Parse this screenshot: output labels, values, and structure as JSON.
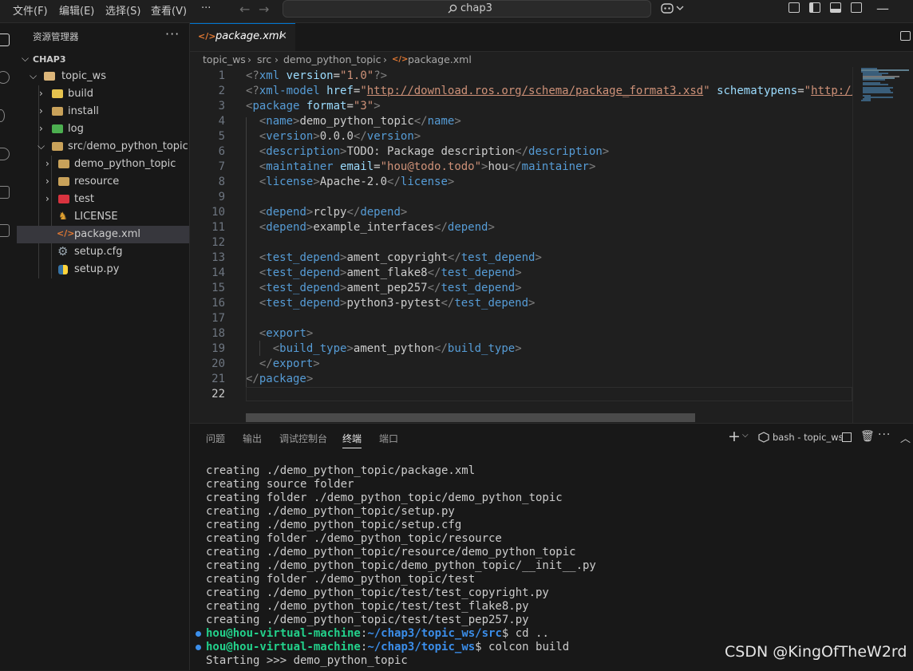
{
  "menu": [
    "文件(F)",
    "编辑(E)",
    "选择(S)",
    "查看(V)",
    "···"
  ],
  "command_center": {
    "text": "chap3",
    "icon": "search-icon"
  },
  "explorer": {
    "title": "资源管理器",
    "more": "···",
    "root": "CHAP3",
    "items": [
      {
        "label": "topic_ws",
        "icon": "folder-open-icon"
      },
      {
        "label": "build",
        "icon": "folder-icon"
      },
      {
        "label": "install",
        "icon": "folder-icon"
      },
      {
        "label": "log",
        "icon": "folder-icon"
      },
      {
        "label": "src",
        "sep": "/",
        "label2": "demo_python_topic",
        "icon": "folder-open-icon"
      },
      {
        "label": "demo_python_topic",
        "icon": "folder-icon"
      },
      {
        "label": "resource",
        "icon": "folder-icon"
      },
      {
        "label": "test",
        "icon": "folder-icon"
      },
      {
        "label": "LICENSE",
        "icon": "license-icon"
      },
      {
        "label": "package.xml",
        "icon": "xml-file-icon",
        "selected": true
      },
      {
        "label": "setup.cfg",
        "icon": "gear-file-icon"
      },
      {
        "label": "setup.py",
        "icon": "python-file-icon"
      }
    ]
  },
  "editor": {
    "tab": {
      "label": "package.xml",
      "icon": "xml-file-icon",
      "close": "✕"
    },
    "breadcrumb": [
      "topic_ws",
      "src",
      "demo_python_topic",
      "package.xml"
    ],
    "line_numbers": [
      "1",
      "2",
      "3",
      "4",
      "5",
      "6",
      "7",
      "8",
      "9",
      "10",
      "11",
      "12",
      "13",
      "14",
      "15",
      "16",
      "17",
      "18",
      "19",
      "20",
      "21",
      "22"
    ],
    "lines": [
      [
        {
          "c": "br",
          "t": "<?"
        },
        {
          "c": "tag",
          "t": "xml "
        },
        {
          "c": "attr",
          "t": "version"
        },
        {
          "c": "txt",
          "t": "="
        },
        {
          "c": "str",
          "t": "\"1.0\""
        },
        {
          "c": "br",
          "t": "?>"
        }
      ],
      [
        {
          "c": "br",
          "t": "<?"
        },
        {
          "c": "tag",
          "t": "xml-model "
        },
        {
          "c": "attr",
          "t": "href"
        },
        {
          "c": "txt",
          "t": "="
        },
        {
          "c": "str",
          "t": "\""
        },
        {
          "c": "link",
          "t": "http://download.ros.org/schema/package_format3.xsd"
        },
        {
          "c": "str",
          "t": "\""
        },
        {
          "c": "txt",
          "t": " "
        },
        {
          "c": "attr",
          "t": "schematypens"
        },
        {
          "c": "txt",
          "t": "="
        },
        {
          "c": "str",
          "t": "\""
        },
        {
          "c": "link",
          "t": "http://"
        }
      ],
      [
        {
          "c": "br",
          "t": "<"
        },
        {
          "c": "tag",
          "t": "package "
        },
        {
          "c": "attr",
          "t": "format"
        },
        {
          "c": "txt",
          "t": "="
        },
        {
          "c": "str",
          "t": "\"3\""
        },
        {
          "c": "br",
          "t": ">"
        }
      ],
      [
        {
          "c": "txt",
          "t": "  "
        },
        {
          "c": "br",
          "t": "<"
        },
        {
          "c": "tag",
          "t": "name"
        },
        {
          "c": "br",
          "t": ">"
        },
        {
          "c": "txt",
          "t": "demo_python_topic"
        },
        {
          "c": "br",
          "t": "</"
        },
        {
          "c": "tag",
          "t": "name"
        },
        {
          "c": "br",
          "t": ">"
        }
      ],
      [
        {
          "c": "txt",
          "t": "  "
        },
        {
          "c": "br",
          "t": "<"
        },
        {
          "c": "tag",
          "t": "version"
        },
        {
          "c": "br",
          "t": ">"
        },
        {
          "c": "txt",
          "t": "0.0.0"
        },
        {
          "c": "br",
          "t": "</"
        },
        {
          "c": "tag",
          "t": "version"
        },
        {
          "c": "br",
          "t": ">"
        }
      ],
      [
        {
          "c": "txt",
          "t": "  "
        },
        {
          "c": "br",
          "t": "<"
        },
        {
          "c": "tag",
          "t": "description"
        },
        {
          "c": "br",
          "t": ">"
        },
        {
          "c": "txt",
          "t": "TODO: Package description"
        },
        {
          "c": "br",
          "t": "</"
        },
        {
          "c": "tag",
          "t": "description"
        },
        {
          "c": "br",
          "t": ">"
        }
      ],
      [
        {
          "c": "txt",
          "t": "  "
        },
        {
          "c": "br",
          "t": "<"
        },
        {
          "c": "tag",
          "t": "maintainer "
        },
        {
          "c": "attr",
          "t": "email"
        },
        {
          "c": "txt",
          "t": "="
        },
        {
          "c": "str",
          "t": "\"hou@todo.todo\""
        },
        {
          "c": "br",
          "t": ">"
        },
        {
          "c": "txt",
          "t": "hou"
        },
        {
          "c": "br",
          "t": "</"
        },
        {
          "c": "tag",
          "t": "maintainer"
        },
        {
          "c": "br",
          "t": ">"
        }
      ],
      [
        {
          "c": "txt",
          "t": "  "
        },
        {
          "c": "br",
          "t": "<"
        },
        {
          "c": "tag",
          "t": "license"
        },
        {
          "c": "br",
          "t": ">"
        },
        {
          "c": "txt",
          "t": "Apache-2.0"
        },
        {
          "c": "br",
          "t": "</"
        },
        {
          "c": "tag",
          "t": "license"
        },
        {
          "c": "br",
          "t": ">"
        }
      ],
      [],
      [
        {
          "c": "txt",
          "t": "  "
        },
        {
          "c": "br",
          "t": "<"
        },
        {
          "c": "tag",
          "t": "depend"
        },
        {
          "c": "br",
          "t": ">"
        },
        {
          "c": "txt",
          "t": "rclpy"
        },
        {
          "c": "br",
          "t": "</"
        },
        {
          "c": "tag",
          "t": "depend"
        },
        {
          "c": "br",
          "t": ">"
        }
      ],
      [
        {
          "c": "txt",
          "t": "  "
        },
        {
          "c": "br",
          "t": "<"
        },
        {
          "c": "tag",
          "t": "depend"
        },
        {
          "c": "br",
          "t": ">"
        },
        {
          "c": "txt",
          "t": "example_interfaces"
        },
        {
          "c": "br",
          "t": "</"
        },
        {
          "c": "tag",
          "t": "depend"
        },
        {
          "c": "br",
          "t": ">"
        }
      ],
      [],
      [
        {
          "c": "txt",
          "t": "  "
        },
        {
          "c": "br",
          "t": "<"
        },
        {
          "c": "tag",
          "t": "test_depend"
        },
        {
          "c": "br",
          "t": ">"
        },
        {
          "c": "txt",
          "t": "ament_copyright"
        },
        {
          "c": "br",
          "t": "</"
        },
        {
          "c": "tag",
          "t": "test_depend"
        },
        {
          "c": "br",
          "t": ">"
        }
      ],
      [
        {
          "c": "txt",
          "t": "  "
        },
        {
          "c": "br",
          "t": "<"
        },
        {
          "c": "tag",
          "t": "test_depend"
        },
        {
          "c": "br",
          "t": ">"
        },
        {
          "c": "txt",
          "t": "ament_flake8"
        },
        {
          "c": "br",
          "t": "</"
        },
        {
          "c": "tag",
          "t": "test_depend"
        },
        {
          "c": "br",
          "t": ">"
        }
      ],
      [
        {
          "c": "txt",
          "t": "  "
        },
        {
          "c": "br",
          "t": "<"
        },
        {
          "c": "tag",
          "t": "test_depend"
        },
        {
          "c": "br",
          "t": ">"
        },
        {
          "c": "txt",
          "t": "ament_pep257"
        },
        {
          "c": "br",
          "t": "</"
        },
        {
          "c": "tag",
          "t": "test_depend"
        },
        {
          "c": "br",
          "t": ">"
        }
      ],
      [
        {
          "c": "txt",
          "t": "  "
        },
        {
          "c": "br",
          "t": "<"
        },
        {
          "c": "tag",
          "t": "test_depend"
        },
        {
          "c": "br",
          "t": ">"
        },
        {
          "c": "txt",
          "t": "python3-pytest"
        },
        {
          "c": "br",
          "t": "</"
        },
        {
          "c": "tag",
          "t": "test_depend"
        },
        {
          "c": "br",
          "t": ">"
        }
      ],
      [],
      [
        {
          "c": "txt",
          "t": "  "
        },
        {
          "c": "br",
          "t": "<"
        },
        {
          "c": "tag",
          "t": "export"
        },
        {
          "c": "br",
          "t": ">"
        }
      ],
      [
        {
          "c": "txt",
          "t": "    "
        },
        {
          "c": "br",
          "t": "<"
        },
        {
          "c": "tag",
          "t": "build_type"
        },
        {
          "c": "br",
          "t": ">"
        },
        {
          "c": "txt",
          "t": "ament_python"
        },
        {
          "c": "br",
          "t": "</"
        },
        {
          "c": "tag",
          "t": "build_type"
        },
        {
          "c": "br",
          "t": ">"
        }
      ],
      [
        {
          "c": "txt",
          "t": "  "
        },
        {
          "c": "br",
          "t": "</"
        },
        {
          "c": "tag",
          "t": "export"
        },
        {
          "c": "br",
          "t": ">"
        }
      ],
      [
        {
          "c": "br",
          "t": "</"
        },
        {
          "c": "tag",
          "t": "package"
        },
        {
          "c": "br",
          "t": ">"
        }
      ],
      []
    ]
  },
  "panel": {
    "tabs": [
      "问题",
      "输出",
      "调试控制台",
      "终端",
      "端口"
    ],
    "active_tab": "终端",
    "terminal_name": "bash - topic_ws",
    "terminal_lines": [
      "creating ./demo_python_topic/package.xml",
      "creating source folder",
      "creating folder ./demo_python_topic/demo_python_topic",
      "creating ./demo_python_topic/setup.py",
      "creating ./demo_python_topic/setup.cfg",
      "creating folder ./demo_python_topic/resource",
      "creating ./demo_python_topic/resource/demo_python_topic",
      "creating ./demo_python_topic/demo_python_topic/__init__.py",
      "creating folder ./demo_python_topic/test",
      "creating ./demo_python_topic/test/test_copyright.py",
      "creating ./demo_python_topic/test/test_flake8.py",
      "creating ./demo_python_topic/test/test_pep257.py"
    ],
    "prompts": [
      {
        "user": "hou@hou-virtual-machine",
        "sep": ":",
        "path": "~/chap3/topic_ws/src",
        "cmd": "$ cd .."
      },
      {
        "user": "hou@hou-virtual-machine",
        "sep": ":",
        "path": "~/chap3/topic_ws",
        "cmd": "$ colcon build"
      }
    ],
    "last_line": "Starting >>> demo_python_topic"
  },
  "watermark": "CSDN @KingOfTheW2rd",
  "colors": {
    "accent": "#0078d4",
    "tag": "#569cd6",
    "attr": "#9cdcfe",
    "string": "#ce9178",
    "prompt_user": "#23d18b",
    "prompt_path": "#3b8eea"
  }
}
